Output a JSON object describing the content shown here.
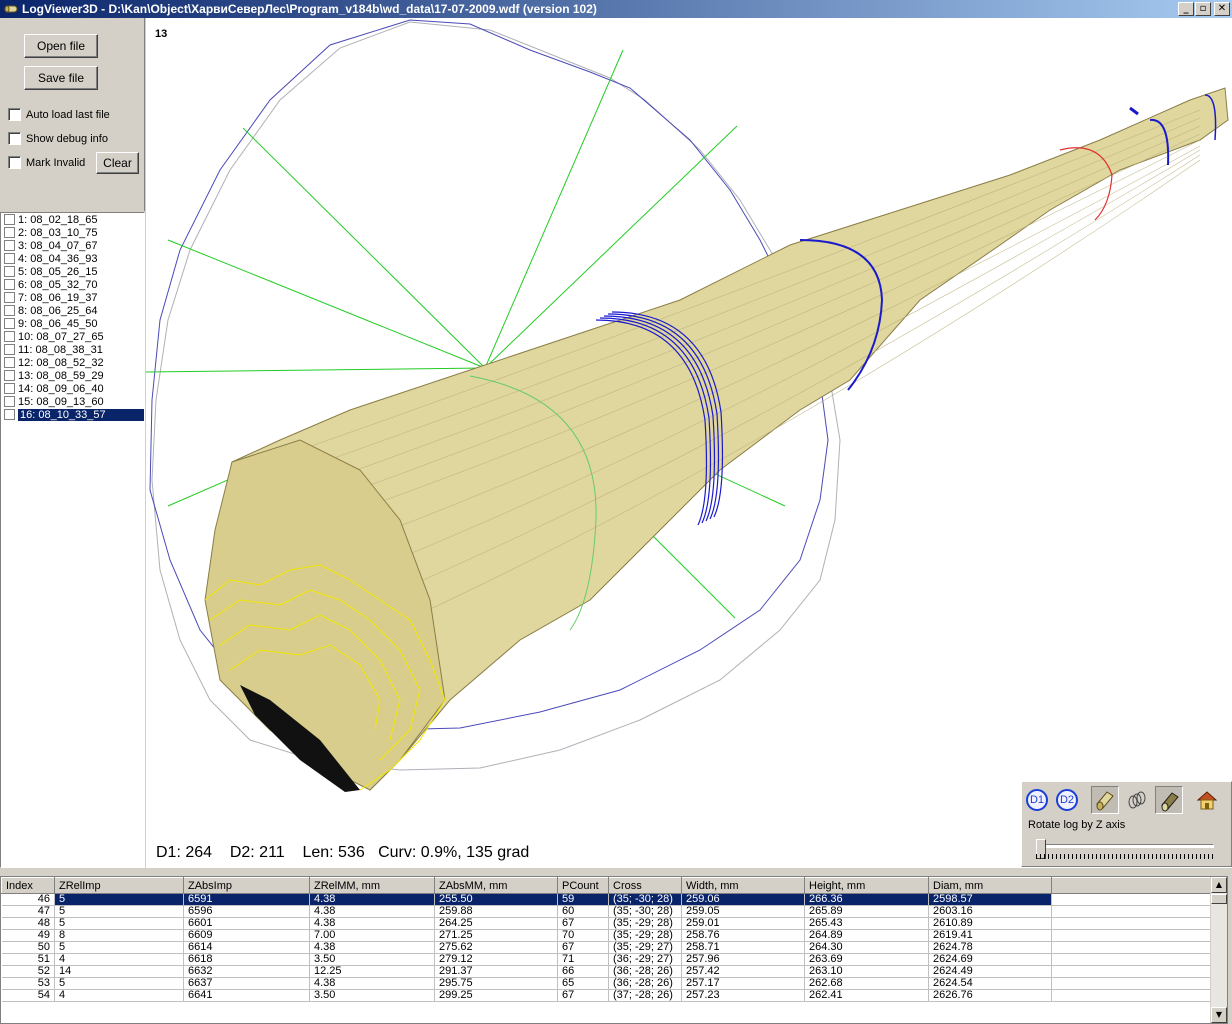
{
  "window": {
    "title": "LogViewer3D - D:\\Kan\\Object\\ХарвиСеверЛес\\Program_v184b\\wd_data\\17-07-2009.wdf (version 102)",
    "buttons": {
      "minimize": "_",
      "maximize": "▫",
      "close": "✕"
    }
  },
  "controls": {
    "open_file": "Open file",
    "save_file": "Save file",
    "auto_load": "Auto load last file",
    "show_debug": "Show debug info",
    "mark_invalid": "Mark Invalid",
    "clear": "Clear"
  },
  "file_list": [
    "1: 08_02_18_65",
    "2: 08_03_10_75",
    "3: 08_04_07_67",
    "4: 08_04_36_93",
    "5: 08_05_26_15",
    "6: 08_05_32_70",
    "7: 08_06_19_37",
    "8: 08_06_25_64",
    "9: 08_06_45_50",
    "10: 08_07_27_65",
    "11: 08_08_38_31",
    "12: 08_08_52_32",
    "13: 08_08_59_29",
    "14: 08_09_06_40",
    "15: 08_09_13_60",
    "16: 08_10_33_57"
  ],
  "selected_file_index": 15,
  "viewport": {
    "frame_number": "13",
    "stats": "D1: 264    D2: 211    Len: 536   Curv: 0.9%, 135 grad"
  },
  "tools": {
    "d1": "D1",
    "d2": "D2",
    "icons": [
      "log-solid-icon",
      "log-rings-icon",
      "log-textured-icon",
      "home-icon"
    ],
    "rotate_label": "Rotate log by Z axis",
    "rotate_value": 0
  },
  "colors": {
    "log_fill": "#e0d79f",
    "selection": "#0a246a",
    "titlebar_start": "#0a246a",
    "titlebar_end": "#a6caf0",
    "section_blue": "#1a1acc",
    "end_yellow": "#f0e800",
    "axes_green": "#22cc22"
  },
  "table": {
    "columns": [
      "Index",
      "ZRelImp",
      "ZAbsImp",
      "ZRelMM, mm",
      "ZAbsMM, mm",
      "PCount",
      "Cross",
      "Width, mm",
      "Height, mm",
      "Diam, mm"
    ],
    "rows": [
      [
        "46",
        "5",
        "6591",
        "4.38",
        "255.50",
        "59",
        "(35; -30; 28)",
        "259.06",
        "266.36",
        "2598.57"
      ],
      [
        "47",
        "5",
        "6596",
        "4.38",
        "259.88",
        "60",
        "(35; -30; 28)",
        "259.05",
        "265.89",
        "2603.16"
      ],
      [
        "48",
        "5",
        "6601",
        "4.38",
        "264.25",
        "67",
        "(35; -29; 28)",
        "259.01",
        "265.43",
        "2610.89"
      ],
      [
        "49",
        "8",
        "6609",
        "7.00",
        "271.25",
        "70",
        "(35; -29; 28)",
        "258.76",
        "264.89",
        "2619.41"
      ],
      [
        "50",
        "5",
        "6614",
        "4.38",
        "275.62",
        "67",
        "(35; -29; 27)",
        "258.71",
        "264.30",
        "2624.78"
      ],
      [
        "51",
        "4",
        "6618",
        "3.50",
        "279.12",
        "71",
        "(36; -29; 27)",
        "257.96",
        "263.69",
        "2624.69"
      ],
      [
        "52",
        "14",
        "6632",
        "12.25",
        "291.37",
        "66",
        "(36; -28; 26)",
        "257.42",
        "263.10",
        "2624.49"
      ],
      [
        "53",
        "5",
        "6637",
        "4.38",
        "295.75",
        "65",
        "(36; -28; 26)",
        "257.17",
        "262.68",
        "2624.54"
      ],
      [
        "54",
        "4",
        "6641",
        "3.50",
        "299.25",
        "67",
        "(37; -28; 26)",
        "257.23",
        "262.41",
        "2626.76"
      ]
    ],
    "selected_row": 0
  }
}
